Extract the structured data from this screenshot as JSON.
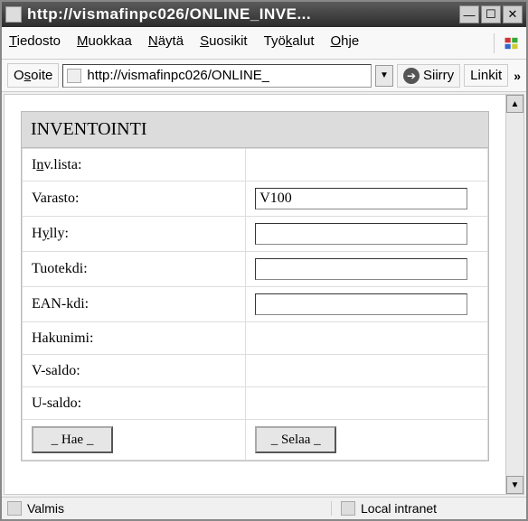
{
  "window": {
    "title": "http://vismafinpc026/ONLINE_INVE..."
  },
  "menubar": {
    "tiedosto": "Tiedosto",
    "muokkaa": "Muokkaa",
    "nayta": "Näytä",
    "suosikit": "Suosikit",
    "tyokalut": "Työkalut",
    "ohje": "Ohje"
  },
  "addrbar": {
    "label": "Osoite",
    "url": "http://vismafinpc026/ONLINE_",
    "go": "Siirry",
    "links": "Linkit"
  },
  "form": {
    "title": "INVENTOINTI",
    "fields": {
      "invlista": {
        "label": "Inv.lista:",
        "value": ""
      },
      "varasto": {
        "label": "Varasto:",
        "value": "V100"
      },
      "hylly": {
        "label": "Hylly:",
        "value": ""
      },
      "tuotekdi": {
        "label": "Tuotekdi:",
        "value": ""
      },
      "eankdi": {
        "label": "EAN-kdi:",
        "value": ""
      },
      "hakunimi": {
        "label": "Hakunimi:",
        "value": ""
      },
      "vsaldo": {
        "label": "V-saldo:",
        "value": ""
      },
      "usaldo": {
        "label": "U-saldo:",
        "value": ""
      }
    },
    "buttons": {
      "hae": "_ Hae _",
      "selaa": "_ Selaa _"
    }
  },
  "status": {
    "text": "Valmis",
    "zone": "Local intranet"
  }
}
